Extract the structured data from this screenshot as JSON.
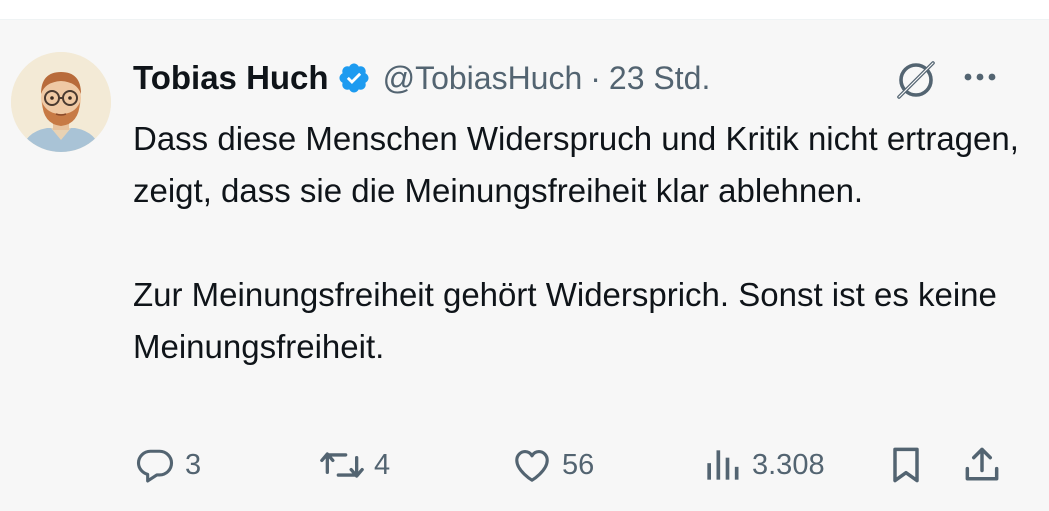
{
  "author": {
    "name": "Tobias Huch",
    "handle": "@TobiasHuch",
    "separator": "·",
    "time": "23 Std.",
    "verified": true,
    "verified_color": "#1d9bf0"
  },
  "tweet": {
    "paragraphs": [
      "Dass diese Menschen Widerspruch und Kritik nicht ertragen, zeigt, dass sie die Meinungsfreiheit klar ablehnen.",
      "Zur Meinungsfreiheit gehört Widersprich. Sonst ist es keine Meinungsfreiheit."
    ]
  },
  "actions": {
    "reply_count": "3",
    "retweet_count": "4",
    "like_count": "56",
    "views_count": "3.308"
  },
  "icons": {
    "reply": "reply-icon",
    "retweet": "retweet-icon",
    "like": "heart-icon",
    "views": "views-icon",
    "bookmark": "bookmark-icon",
    "share": "share-icon",
    "grok": "grok-icon",
    "more": "more-icon"
  },
  "colors": {
    "text_primary": "#0f1419",
    "text_secondary": "#536471",
    "background": "#f7f7f7"
  }
}
